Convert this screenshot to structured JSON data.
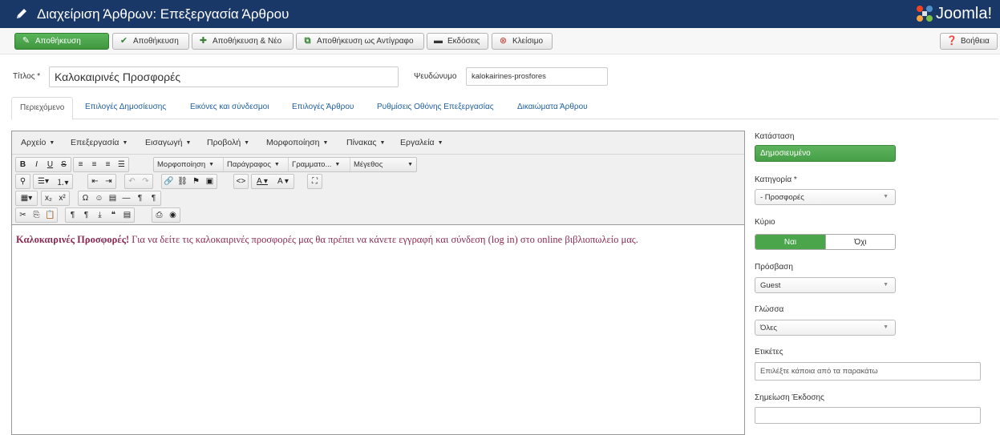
{
  "header": {
    "title": "Διαχείριση Άρθρων: Επεξεργασία Άρθρου",
    "logo_text": "Joomla!"
  },
  "toolbar": {
    "save": "Αποθήκευση",
    "save_close": "Αποθήκευση",
    "save_new": "Αποθήκευση & Νέο",
    "save_copy": "Αποθήκευση ως Αντίγραφο",
    "versions": "Εκδόσεις",
    "close": "Κλείσιμο",
    "help": "Βοήθεια"
  },
  "form": {
    "title_label": "Τίτλος *",
    "title_value": "Καλοκαιρινές Προσφορές",
    "alias_label": "Ψευδώνυμο",
    "alias_value": "kalokairines-prosfores"
  },
  "tabs": [
    "Περιεχόμενο",
    "Επιλογές Δημοσίευσης",
    "Εικόνες και σύνδεσμοι",
    "Επιλογές Άρθρου",
    "Ρυθμίσεις Οθόνης Επεξεργασίας",
    "Δικαιώματα Άρθρου"
  ],
  "editor": {
    "menus": [
      "Αρχείο",
      "Επεξεργασία",
      "Εισαγωγή",
      "Προβολή",
      "Μορφοποίηση",
      "Πίνακας",
      "Εργαλεία"
    ],
    "format_select": "Μορφοποίηση",
    "paragraph_select": "Παράγραφος",
    "font_select": "Γραμματο...",
    "size_select": "Μέγεθος",
    "content_bold": "Καλοκαιρινές Προσφορές!",
    "content_text": " Για να δείτε τις καλοκαιρινές προσφορές μας θα πρέπει να κάνετε εγγραφή και σύνδεση (log in) στο online βιβλιοπωλείο μας."
  },
  "sidebar": {
    "status_label": "Κατάσταση",
    "status_value": "Δημοσιευμένο",
    "category_label": "Κατηγορία *",
    "category_value": "- Προσφορές",
    "featured_label": "Κύριο",
    "featured_yes": "Ναι",
    "featured_no": "Όχι",
    "access_label": "Πρόσβαση",
    "access_value": "Guest",
    "language_label": "Γλώσσα",
    "language_value": "Όλες",
    "tags_label": "Ετικέτες",
    "tags_placeholder": "Επιλέξτε κάποια από τα παρακάτω",
    "version_note_label": "Σημείωση Έκδοσης",
    "version_note_value": ""
  },
  "colors": {
    "header_bg": "#1a3867",
    "success": "#46a046",
    "link": "#1f5e9e",
    "content_text": "#8a2a52"
  }
}
